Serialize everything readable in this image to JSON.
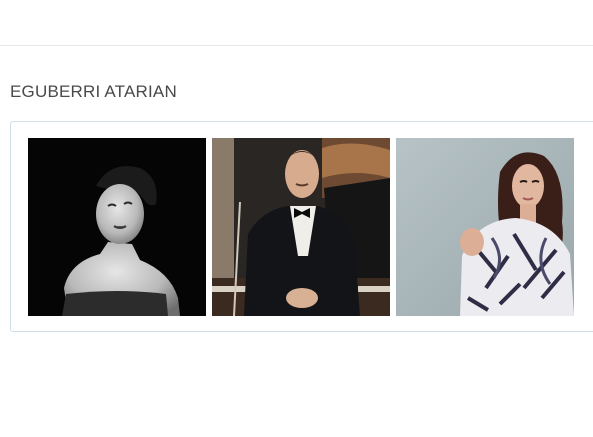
{
  "section": {
    "title": "EGUBERRI ATARIAN"
  },
  "gallery": {
    "photos": [
      {
        "subject": "woman-portrait-black-and-white"
      },
      {
        "subject": "man-in-tuxedo-at-piano"
      },
      {
        "subject": "woman-in-patterned-blouse"
      }
    ]
  },
  "colors": {
    "title_text": "#4a4a4a",
    "panel_border": "#cfe0e8",
    "divider": "#e6e6e6"
  }
}
